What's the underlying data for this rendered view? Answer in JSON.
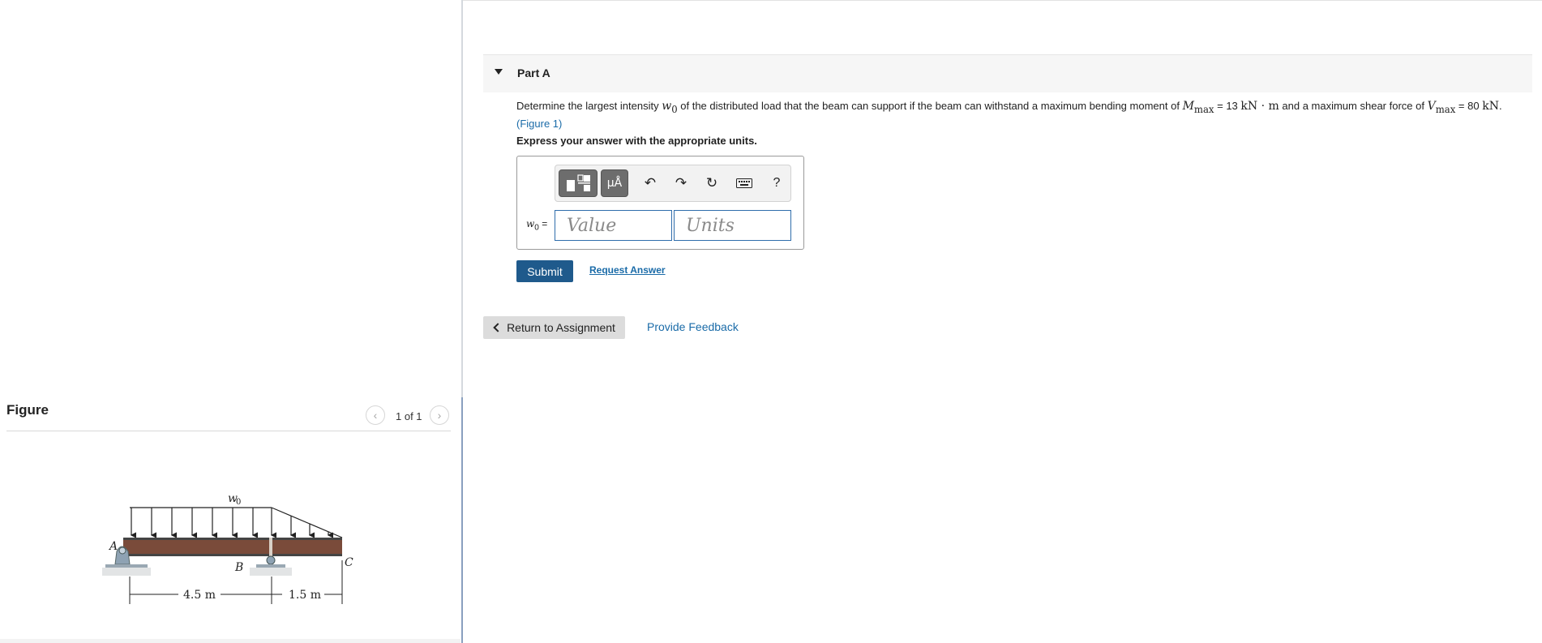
{
  "figure": {
    "title": "Figure",
    "counter": "1 of 1",
    "labels": {
      "load": "w0",
      "point_a": "A",
      "point_b": "B",
      "point_c": "C",
      "span_ab": "4.5 m",
      "span_bc": "1.5 m"
    }
  },
  "part": {
    "title": "Part A",
    "question": {
      "lead": "Determine the largest intensity",
      "var_w": "w",
      "var_w_sub": "0",
      "mid": "of the distributed load that the beam can support if the beam can withstand a maximum bending moment of",
      "m_sym": "M",
      "m_sub": "max",
      "m_eq": "= 13",
      "m_unit": "kN · m",
      "mid2": "and a maximum shear force of",
      "v_sym": "V",
      "v_sub": "max",
      "v_eq": "= 80",
      "v_unit": "kN",
      "period": ".",
      "figure_link": "(Figure 1)"
    },
    "instruction": "Express your answer with the appropriate units."
  },
  "answer": {
    "toolbar": {
      "units_label": "μÅ",
      "undo": "↶",
      "redo": "↷",
      "reset": "↻",
      "help": "?"
    },
    "variable": "w",
    "variable_sub": "0",
    "equals": "=",
    "value_placeholder": "Value",
    "units_placeholder": "Units"
  },
  "actions": {
    "submit": "Submit",
    "request_answer": "Request Answer",
    "return": "Return to Assignment",
    "feedback": "Provide Feedback"
  }
}
